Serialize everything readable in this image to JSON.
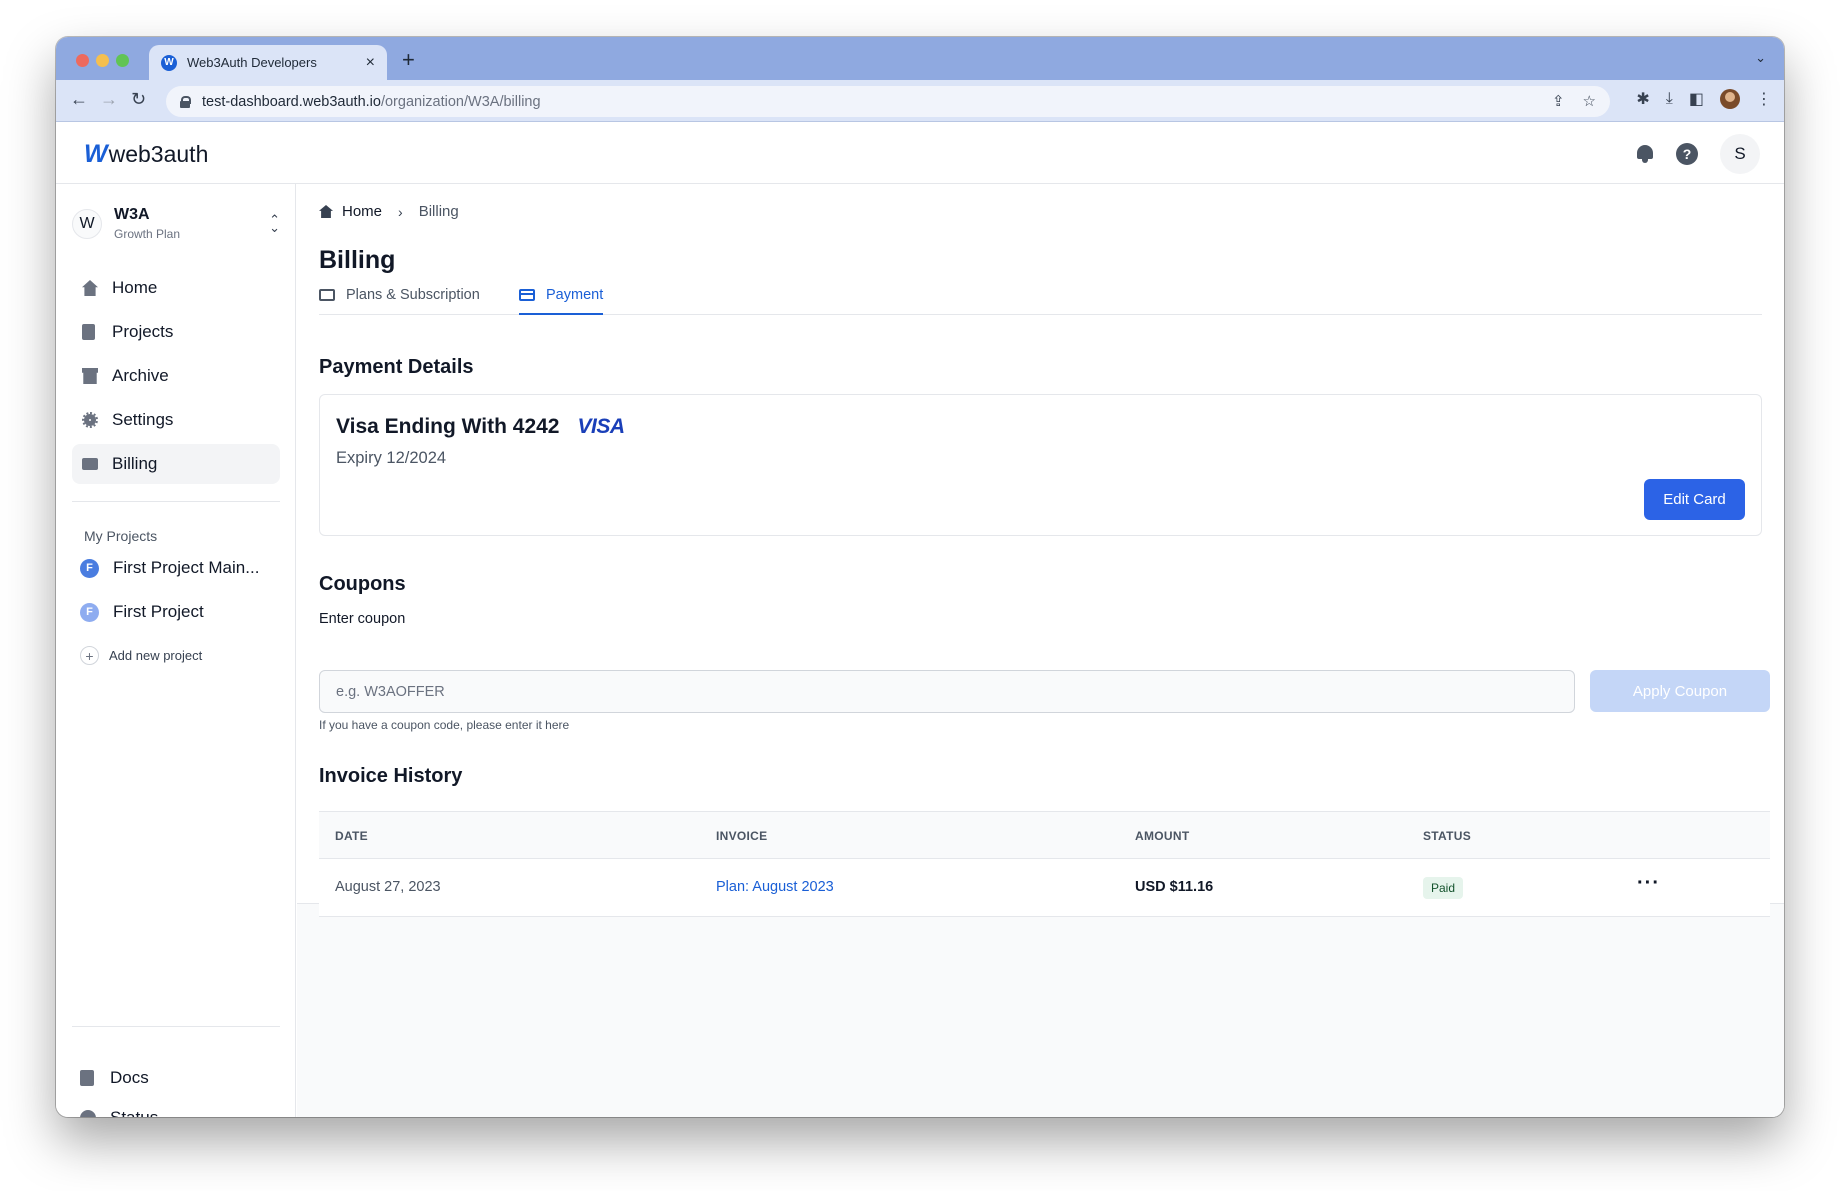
{
  "browser": {
    "tab_title": "Web3Auth Developers",
    "tab_favicon": "W",
    "url_host": "test-dashboard.web3auth.io",
    "url_path": "/organization/W3A/billing"
  },
  "header": {
    "logo_mark": "W",
    "logo_text": "web3auth",
    "avatar_initial": "S",
    "help_glyph": "?"
  },
  "sidebar": {
    "org_initial": "W",
    "org_name": "W3A",
    "org_plan": "Growth Plan",
    "items": [
      {
        "label": "Home",
        "icon": "home-icon"
      },
      {
        "label": "Projects",
        "icon": "document-icon"
      },
      {
        "label": "Archive",
        "icon": "archive-icon"
      },
      {
        "label": "Settings",
        "icon": "gear-icon"
      },
      {
        "label": "Billing",
        "icon": "credit-card-icon"
      }
    ],
    "my_projects_title": "My Projects",
    "projects": [
      {
        "initial": "F",
        "name": "First Project Main..."
      },
      {
        "initial": "F",
        "name": "First Project"
      }
    ],
    "add_project_label": "Add new project",
    "bottom": [
      {
        "label": "Docs",
        "icon": "document-icon"
      },
      {
        "label": "Status",
        "icon": "check-circle-icon"
      }
    ]
  },
  "main": {
    "breadcrumb": {
      "home": "Home",
      "current": "Billing"
    },
    "title": "Billing",
    "tabs": [
      {
        "label": "Plans & Subscription",
        "active": false
      },
      {
        "label": "Payment",
        "active": true
      }
    ],
    "payment": {
      "section_title": "Payment Details",
      "card_title": "Visa Ending With 4242",
      "brand": "VISA",
      "expiry": "Expiry 12/2024",
      "edit_label": "Edit Card"
    },
    "coupons": {
      "section_title": "Coupons",
      "field_label": "Enter coupon",
      "placeholder": "e.g. W3AOFFER",
      "value": "",
      "button_label": "Apply Coupon",
      "hint": "If you have a coupon code, please enter it here"
    },
    "invoices": {
      "section_title": "Invoice History",
      "columns": [
        "DATE",
        "INVOICE",
        "AMOUNT",
        "STATUS"
      ],
      "rows": [
        {
          "date": "August 27, 2023",
          "invoice": "Plan: August 2023",
          "amount": "USD $11.16",
          "status": "Paid"
        }
      ]
    }
  },
  "colors": {
    "accent": "#2c63e6",
    "browser_tabstrip": "#8fa9e0",
    "status_paid_bg": "#e6f4ec"
  }
}
